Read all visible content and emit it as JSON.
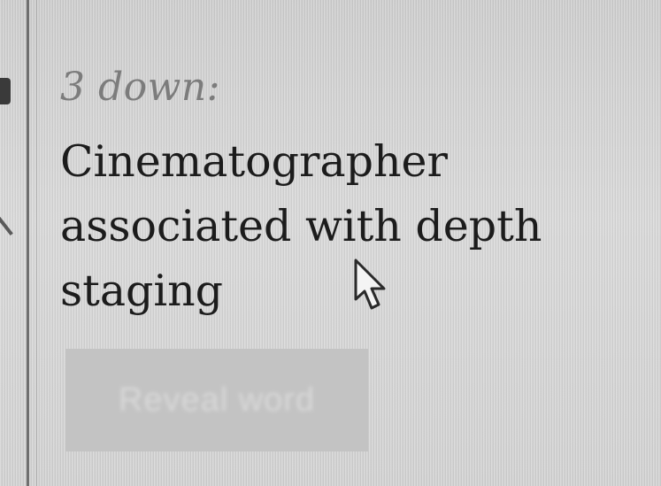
{
  "clue": {
    "number_label": "3 down:",
    "line1": "Cinematographer",
    "line2": "associated with depth",
    "line3": "staging"
  },
  "button": {
    "label": "Reveal word"
  },
  "icons": {
    "cursor": "arrow-pointer-icon"
  },
  "colors": {
    "text_primary": "#1c1c1c",
    "text_secondary": "#7c7c7c",
    "button_bg": "#c3c3c3"
  }
}
